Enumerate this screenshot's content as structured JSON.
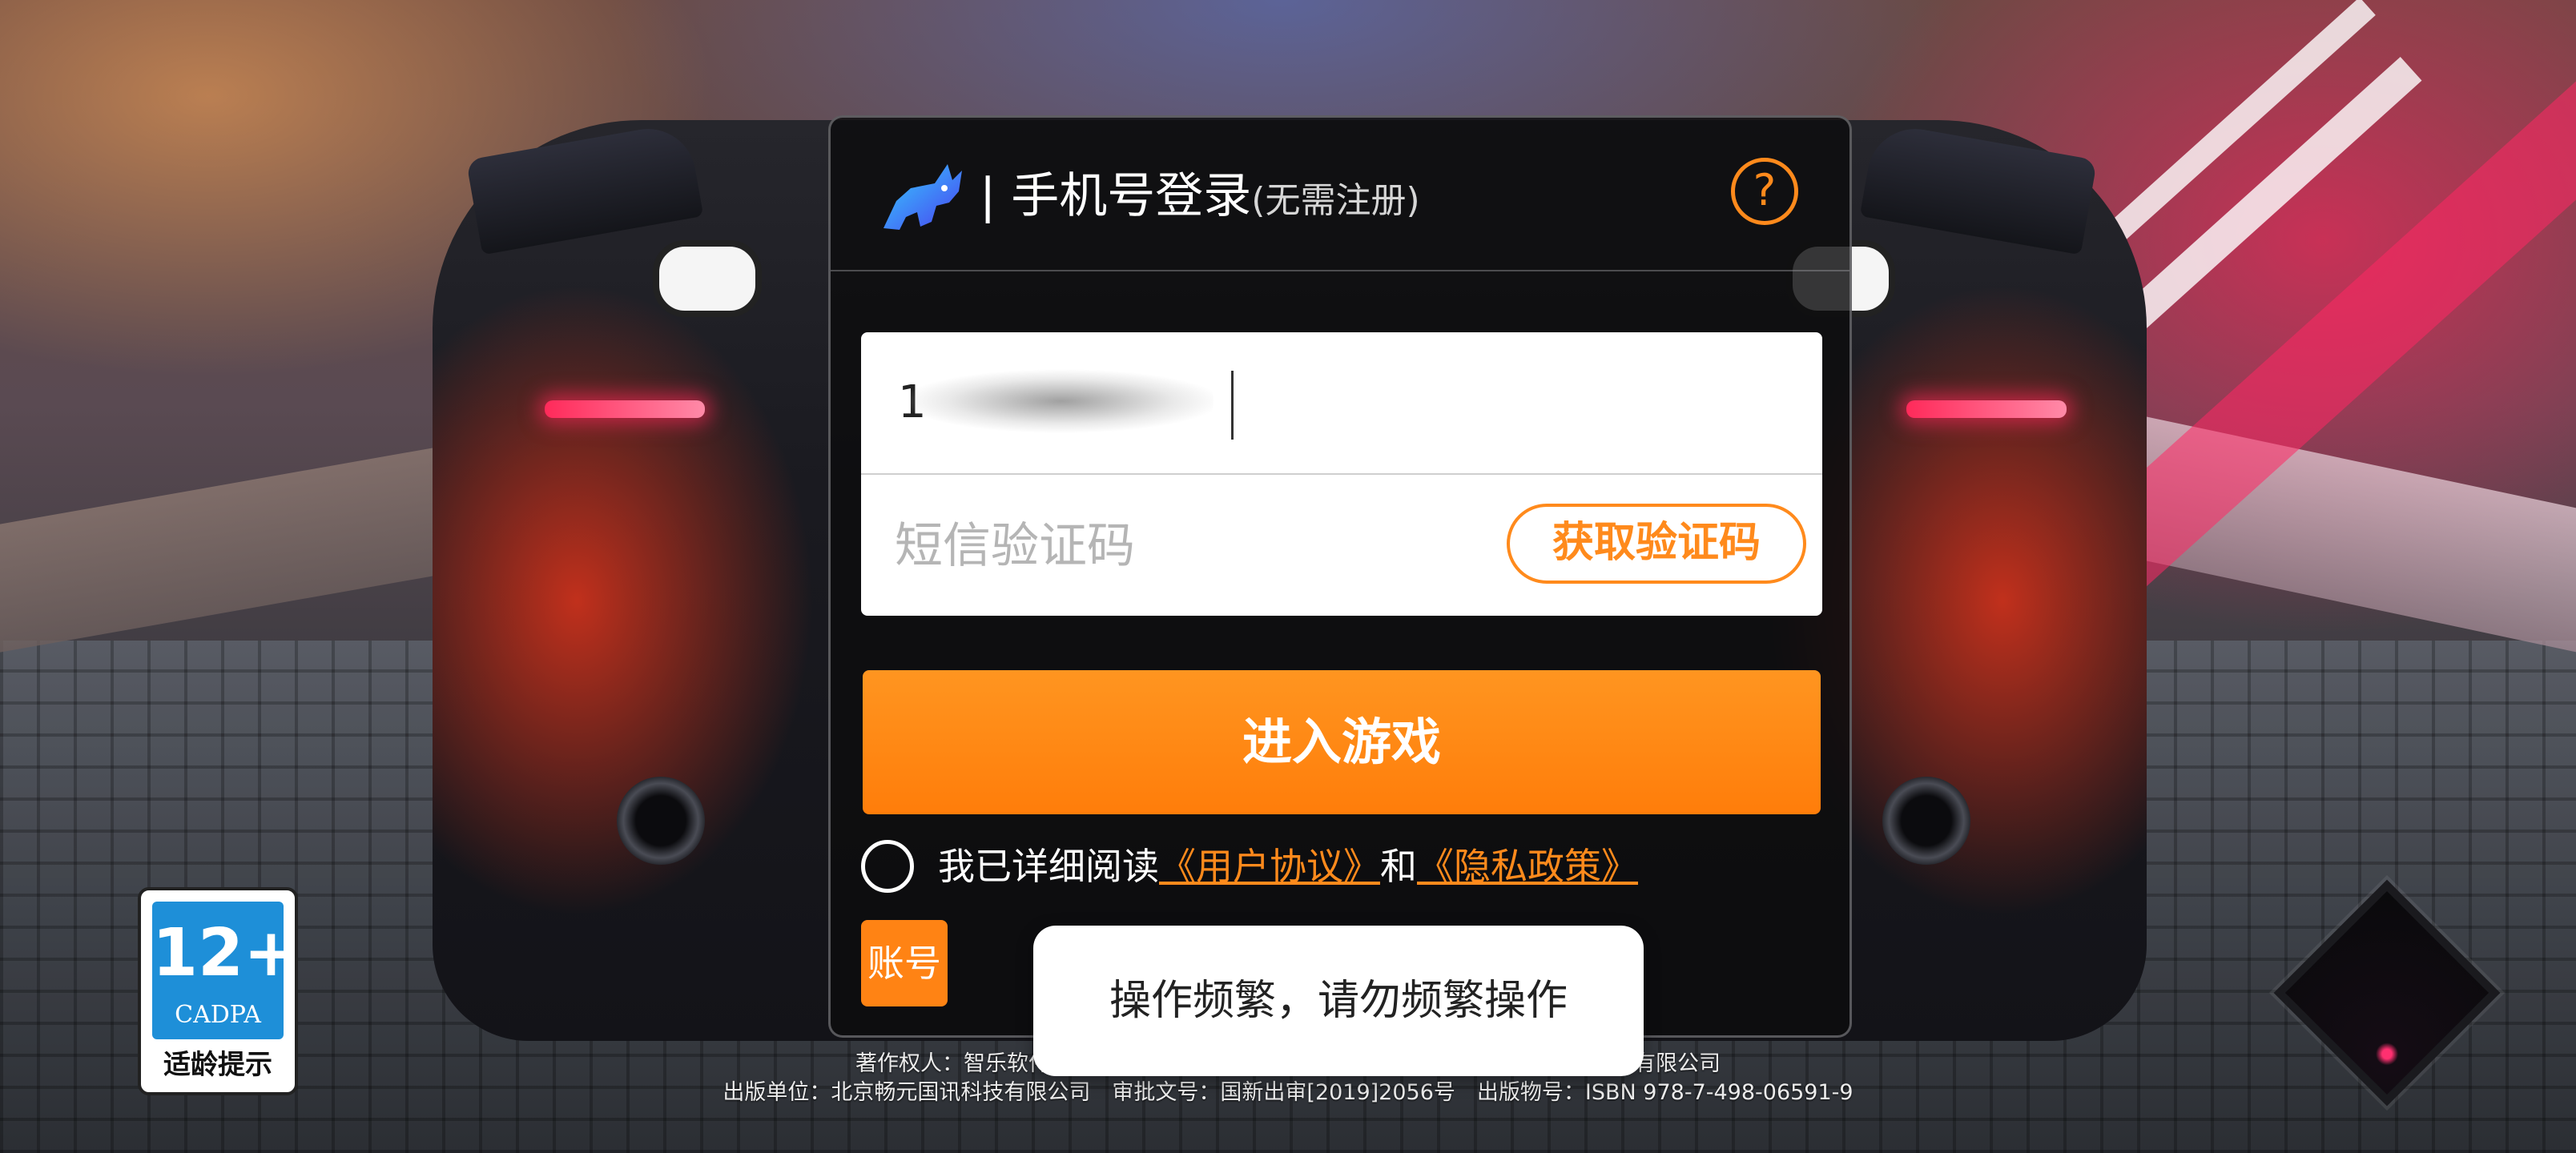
{
  "dialog": {
    "title": "| 手机号登录",
    "title_sub": "(无需注册)",
    "help_symbol": "?",
    "phone_value": "1",
    "code_placeholder": "短信验证码",
    "get_code_label": "获取验证码",
    "enter_label": "进入游戏",
    "agree_prefix": "我已详细阅读",
    "user_agreement": "《用户协议》",
    "and": "和",
    "privacy_policy": "《隐私政策》",
    "account_label": "账号"
  },
  "toast": {
    "message": "操作频繁，请勿频繁操作"
  },
  "footer": {
    "line1": "著作权人：智乐软件（北京）有限公司　　　　　　　　　　　　　九游信息技术有限公司",
    "line2": "出版单位：北京畅元国讯科技有限公司　审批文号：国新出审[2019]2056号　出版物号：ISBN 978-7-498-06591-9"
  },
  "age_rating": {
    "number": "12+",
    "org": "CADPA",
    "label": "适龄提示"
  },
  "colors": {
    "accent": "#ff8a1c",
    "button": "#ff8314",
    "age_badge_blue": "#1e8fd8"
  },
  "icons": {
    "logo": "rhino-logo-icon",
    "help": "question-circle-icon",
    "corner": "diamond-icon"
  }
}
